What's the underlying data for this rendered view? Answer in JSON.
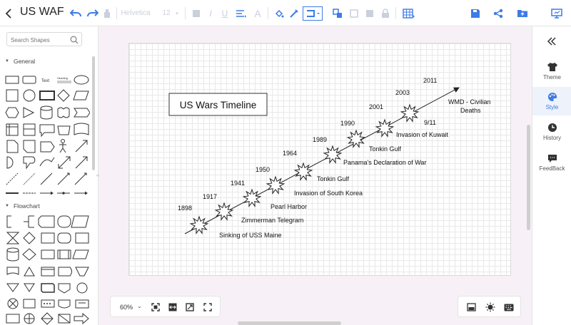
{
  "app": {
    "title": "US WAF",
    "accent_color": "#3d7be6"
  },
  "toolbar": {
    "font_name": "Helvetica",
    "font_size": "12",
    "icons": [
      "back-icon",
      "undo-icon",
      "redo-icon",
      "format-painter-icon",
      "bold-icon",
      "italic-icon",
      "underline-icon",
      "align-icon",
      "font-color-icon",
      "fill-color-icon",
      "line-color-icon",
      "connector-style-icon",
      "arrange-icon",
      "group-icon",
      "copy-style-icon",
      "lock-icon",
      "table-icon",
      "save-icon",
      "share-icon",
      "export-icon",
      "present-icon"
    ]
  },
  "left_panel": {
    "search_placeholder": "Search Shapes",
    "sections": [
      {
        "label": "General"
      },
      {
        "label": "Flowchart"
      }
    ],
    "text_shape_label": "Text",
    "heading_shape_label": "Heading"
  },
  "diagram": {
    "title": "US Wars Timeline",
    "events": [
      {
        "year": "1898",
        "label": "Sinking of USS Maine"
      },
      {
        "year": "1917",
        "label": "Zimmerman Telegram"
      },
      {
        "year": "1941",
        "label": "Pearl Harbor"
      },
      {
        "year": "1950",
        "label": "Invasion of South Korea"
      },
      {
        "year": "1964",
        "label": "Tonkin Gulf"
      },
      {
        "year": "1989",
        "label": "Panama's Declaration of War"
      },
      {
        "year": "1990",
        "label": "Invasion of Kuwait"
      },
      {
        "year": "2001",
        "label": "9/11"
      },
      {
        "year": "2003",
        "label": "WMD - Civilian"
      },
      {
        "year": "2011",
        "label": "Deaths"
      }
    ],
    "extra_label": "Tonkin Gulf"
  },
  "zoom": {
    "level": "60%"
  },
  "right_panel": {
    "items": [
      {
        "label": "Theme",
        "icon": "shirt-icon"
      },
      {
        "label": "Style",
        "icon": "palette-icon",
        "active": true
      },
      {
        "label": "History",
        "icon": "clock-icon"
      },
      {
        "label": "FeedBack",
        "icon": "feedback-icon"
      }
    ]
  }
}
